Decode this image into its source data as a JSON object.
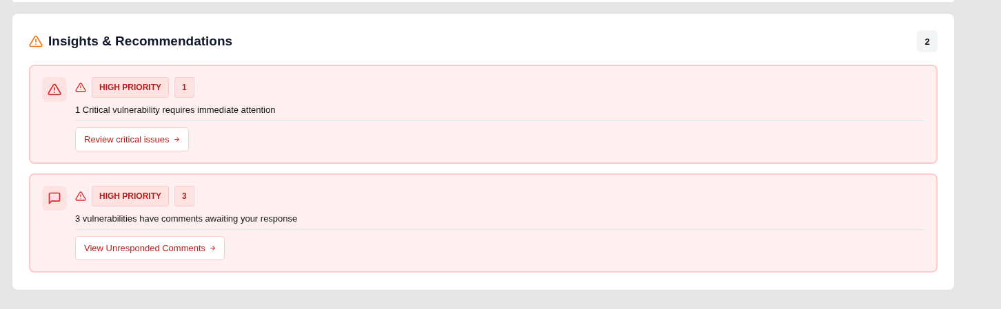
{
  "panel": {
    "title": "Insights & Recommendations",
    "count": "2"
  },
  "insights": [
    {
      "kind": "critical",
      "priority": "HIGH PRIORITY",
      "count": "1",
      "message": "1 Critical vulnerability requires immediate attention",
      "action": "Review critical issues"
    },
    {
      "kind": "comments",
      "priority": "HIGH PRIORITY",
      "count": "3",
      "message": "3 vulnerabilities have comments awaiting your response",
      "action": "View Unresponded Comments"
    }
  ]
}
